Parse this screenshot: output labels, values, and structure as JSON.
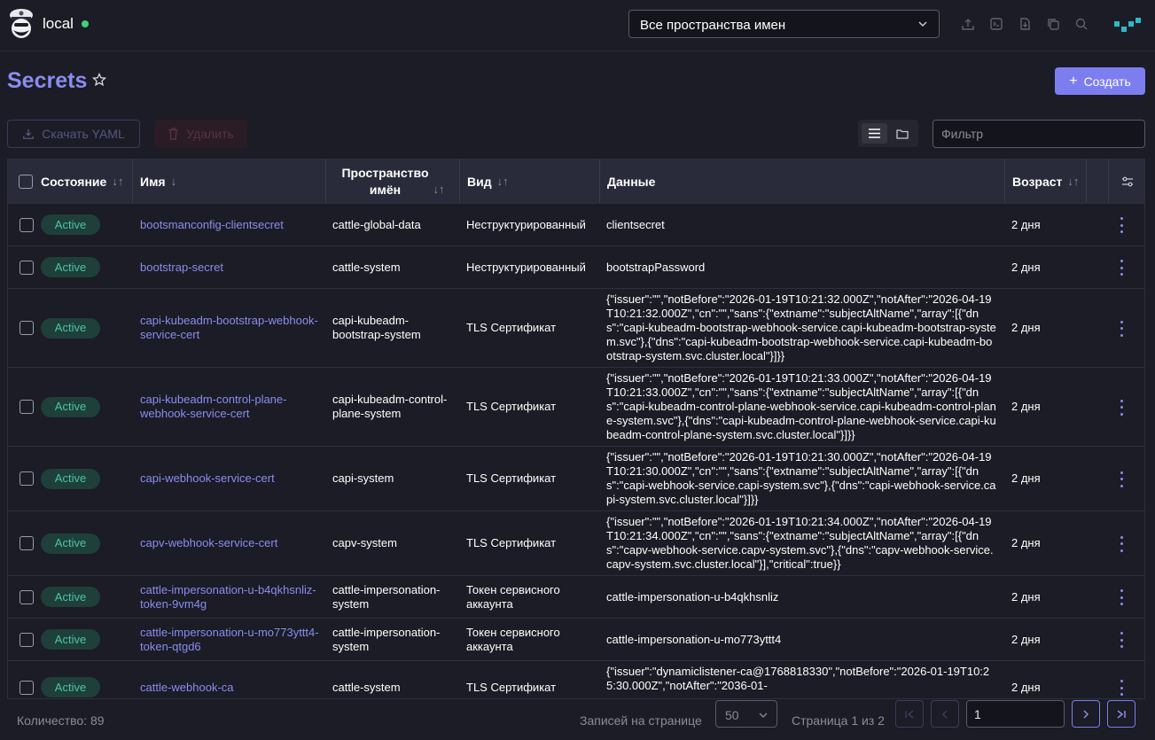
{
  "header": {
    "cluster_name": "local",
    "namespace_select": "Все пространства имен",
    "icons": [
      "import-yaml-icon",
      "kubectl-shell-icon",
      "download-kubeconfig-icon",
      "copy-kubeconfig-icon",
      "search-icon"
    ]
  },
  "page": {
    "title": "Secrets",
    "create_label": "Создать",
    "download_yaml_label": "Скачать YAML",
    "delete_label": "Удалить",
    "filter_placeholder": "Фильтр"
  },
  "table": {
    "columns": {
      "state": "Состояние",
      "name": "Имя",
      "namespace": "Пространство имён",
      "type": "Вид",
      "data": "Данные",
      "age": "Возраст"
    },
    "rows": [
      {
        "state": "Active",
        "name": "bootsmanconfig-clientsecret",
        "namespace": "cattle-global-data",
        "type": "Неструктурированный",
        "data": "clientsecret",
        "age": "2 дня"
      },
      {
        "state": "Active",
        "name": "bootstrap-secret",
        "namespace": "cattle-system",
        "type": "Неструктурированный",
        "data": "bootstrapPassword",
        "age": "2 дня"
      },
      {
        "state": "Active",
        "name": "capi-kubeadm-bootstrap-webhook-service-cert",
        "namespace": "capi-kubeadm-bootstrap-system",
        "type": "TLS Сертификат",
        "data": "{\"issuer\":\"\",\"notBefore\":\"2026-01-19T10:21:32.000Z\",\"notAfter\":\"2026-04-19T10:21:32.000Z\",\"cn\":\"\",\"sans\":{\"extname\":\"subjectAltName\",\"array\":[{\"dns\":\"capi-kubeadm-bootstrap-webhook-service.capi-kubeadm-bootstrap-system.svc\"},{\"dns\":\"capi-kubeadm-bootstrap-webhook-service.capi-kubeadm-bootstrap-system.svc.cluster.local\"}]}}",
        "age": "2 дня"
      },
      {
        "state": "Active",
        "name": "capi-kubeadm-control-plane-webhook-service-cert",
        "namespace": "capi-kubeadm-control-plane-system",
        "type": "TLS Сертификат",
        "data": "{\"issuer\":\"\",\"notBefore\":\"2026-01-19T10:21:33.000Z\",\"notAfter\":\"2026-04-19T10:21:33.000Z\",\"cn\":\"\",\"sans\":{\"extname\":\"subjectAltName\",\"array\":[{\"dns\":\"capi-kubeadm-control-plane-webhook-service.capi-kubeadm-control-plane-system.svc\"},{\"dns\":\"capi-kubeadm-control-plane-webhook-service.capi-kubeadm-control-plane-system.svc.cluster.local\"}]}}",
        "age": "2 дня"
      },
      {
        "state": "Active",
        "name": "capi-webhook-service-cert",
        "namespace": "capi-system",
        "type": "TLS Сертификат",
        "data": "{\"issuer\":\"\",\"notBefore\":\"2026-01-19T10:21:30.000Z\",\"notAfter\":\"2026-04-19T10:21:30.000Z\",\"cn\":\"\",\"sans\":{\"extname\":\"subjectAltName\",\"array\":[{\"dns\":\"capi-webhook-service.capi-system.svc\"},{\"dns\":\"capi-webhook-service.capi-system.svc.cluster.local\"}]}}",
        "age": "2 дня"
      },
      {
        "state": "Active",
        "name": "capv-webhook-service-cert",
        "namespace": "capv-system",
        "type": "TLS Сертификат",
        "data": "{\"issuer\":\"\",\"notBefore\":\"2026-01-19T10:21:34.000Z\",\"notAfter\":\"2026-04-19T10:21:34.000Z\",\"cn\":\"\",\"sans\":{\"extname\":\"subjectAltName\",\"array\":[{\"dns\":\"capv-webhook-service.capv-system.svc\"},{\"dns\":\"capv-webhook-service.capv-system.svc.cluster.local\"}],\"critical\":true}}",
        "age": "2 дня"
      },
      {
        "state": "Active",
        "name": "cattle-impersonation-u-b4qkhsnliz-token-9vm4g",
        "namespace": "cattle-impersonation-system",
        "type": "Токен сервисного аккаунта",
        "data": "cattle-impersonation-u-b4qkhsnliz",
        "age": "2 дня"
      },
      {
        "state": "Active",
        "name": "cattle-impersonation-u-mo773yttt4-token-qtgd6",
        "namespace": "cattle-impersonation-system",
        "type": "Токен сервисного аккаунта",
        "data": "cattle-impersonation-u-mo773yttt4",
        "age": "2 дня"
      },
      {
        "state": "Active",
        "name": "cattle-webhook-ca",
        "namespace": "cattle-system",
        "type": "TLS Сертификат",
        "data": "{\"issuer\":\"dynamiclistener-ca@1768818330\",\"notBefore\":\"2026-01-19T10:25:30.000Z\",\"notAfter\":\"2036-01-",
        "age": "2 дня"
      }
    ]
  },
  "footer": {
    "count": "Количество: 89",
    "per_page_label": "Записей на странице",
    "per_page_value": "50",
    "page_info": "Страница 1 из 2",
    "page_input": "1"
  },
  "colors": {
    "accent": "#7c7ef0",
    "link": "#8a8cf0",
    "active_badge_bg": "#1e3f3a",
    "active_badge_text": "#4cc4a8",
    "status_dot": "#3fd27a"
  }
}
